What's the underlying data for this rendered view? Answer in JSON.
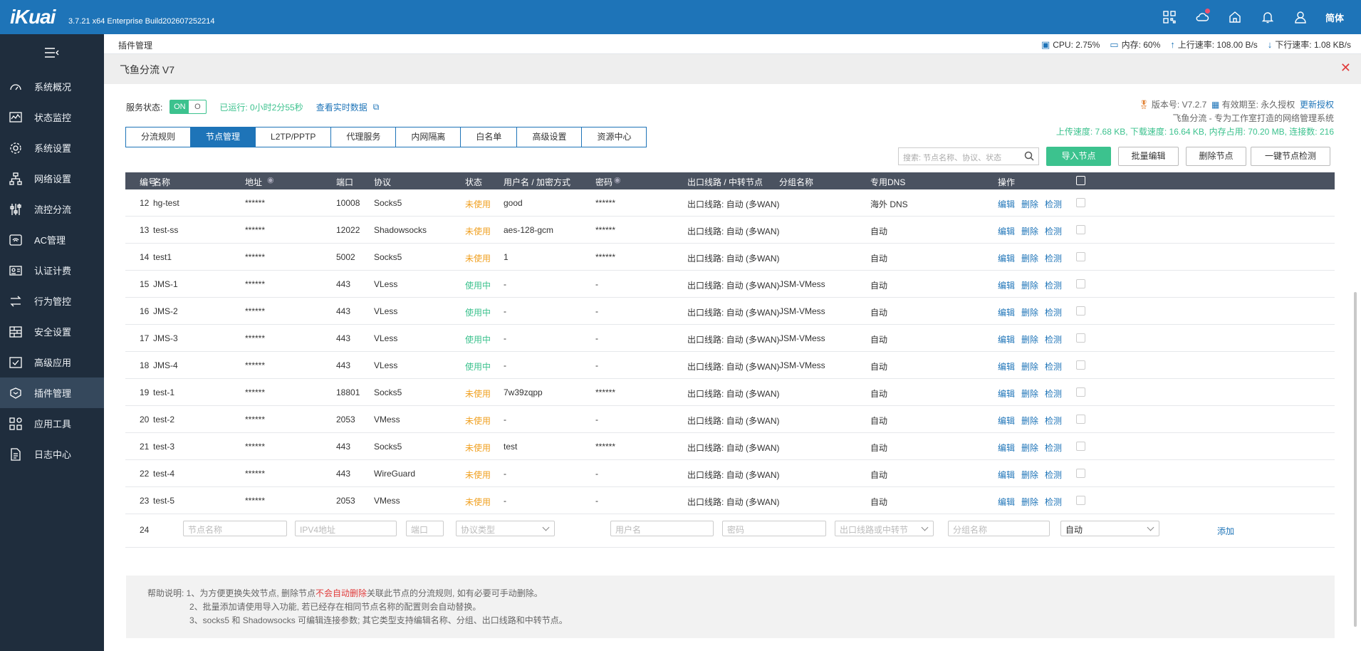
{
  "topbar": {
    "logo": "iKuai",
    "version": "3.7.21 x64 Enterprise Build202607252214",
    "lang": "简体"
  },
  "sidebar": {
    "items": [
      {
        "label": "系统概况",
        "icon": "dashboard-icon"
      },
      {
        "label": "状态监控",
        "icon": "monitor-icon"
      },
      {
        "label": "系统设置",
        "icon": "gear-icon"
      },
      {
        "label": "网络设置",
        "icon": "network-icon"
      },
      {
        "label": "流控分流",
        "icon": "sliders-icon"
      },
      {
        "label": "AC管理",
        "icon": "wifi-icon"
      },
      {
        "label": "认证计费",
        "icon": "id-card-icon"
      },
      {
        "label": "行为管控",
        "icon": "arrows-icon"
      },
      {
        "label": "安全设置",
        "icon": "firewall-icon"
      },
      {
        "label": "高级应用",
        "icon": "check-square-icon"
      },
      {
        "label": "插件管理",
        "icon": "plugin-icon"
      },
      {
        "label": "应用工具",
        "icon": "apps-icon"
      },
      {
        "label": "日志中心",
        "icon": "document-icon"
      }
    ],
    "active_index": 10
  },
  "statusbar": {
    "breadcrumb": "插件管理",
    "cpu": "CPU: 2.75%",
    "memory": "内存: 60%",
    "upload": "上行速率: 108.00 B/s",
    "download": "下行速率: 1.08 KB/s"
  },
  "panel": {
    "title": "飞鱼分流 V7",
    "service_label": "服务状态:",
    "toggle_on": "ON",
    "toggle_off": "O",
    "runtime": "已运行: 0小时2分55秒",
    "realtime_link": "查看实时数据",
    "version_label": "版本号: V7.2.7",
    "validity": "有效期至: 永久授权",
    "update_license": "更新授权",
    "tagline": "飞鱼分流 - 专为工作室打造的网络管理系统",
    "speeds": "上传速度: 7.68 KB, 下载速度: 16.64 KB, 内存占用: 70.20 MB, 连接数: 216"
  },
  "tabs": [
    "分流规则",
    "节点管理",
    "L2TP/PPTP",
    "代理服务",
    "内网隔离",
    "白名单",
    "高级设置",
    "资源中心"
  ],
  "active_tab": 1,
  "toolbar": {
    "search_placeholder": "搜索: 节点名称、协议、状态",
    "import": "导入节点",
    "batch_edit": "批量编辑",
    "delete": "删除节点",
    "check_all": "一键节点检测"
  },
  "table": {
    "headers": [
      "编号",
      "名称",
      "地址",
      "端口",
      "协议",
      "状态",
      "用户名 / 加密方式",
      "密码",
      "出口线路 / 中转节点",
      "分组名称",
      "专用DNS",
      "操作"
    ],
    "actions": [
      "编辑",
      "删除",
      "检测"
    ],
    "rows": [
      {
        "id": "12",
        "name": "hg-test",
        "addr": "******",
        "port": "10008",
        "proto": "Socks5",
        "status": "未使用",
        "used": false,
        "user": "good",
        "pwd": "******",
        "exit": "出口线路: 自动 (多WAN)",
        "group": "",
        "dns": "海外 DNS"
      },
      {
        "id": "13",
        "name": "test-ss",
        "addr": "******",
        "port": "12022",
        "proto": "Shadowsocks",
        "status": "未使用",
        "used": false,
        "user": "aes-128-gcm",
        "pwd": "******",
        "exit": "出口线路: 自动 (多WAN)",
        "group": "",
        "dns": "自动"
      },
      {
        "id": "14",
        "name": "test1",
        "addr": "******",
        "port": "5002",
        "proto": "Socks5",
        "status": "未使用",
        "used": false,
        "user": "1",
        "pwd": "******",
        "exit": "出口线路: 自动 (多WAN)",
        "group": "",
        "dns": "自动"
      },
      {
        "id": "15",
        "name": "JMS-1",
        "addr": "******",
        "port": "443",
        "proto": "VLess",
        "status": "使用中",
        "used": true,
        "user": "-",
        "pwd": "-",
        "exit": "出口线路: 自动 (多WAN)",
        "group": "JSM-VMess",
        "dns": "自动"
      },
      {
        "id": "16",
        "name": "JMS-2",
        "addr": "******",
        "port": "443",
        "proto": "VLess",
        "status": "使用中",
        "used": true,
        "user": "-",
        "pwd": "-",
        "exit": "出口线路: 自动 (多WAN)",
        "group": "JSM-VMess",
        "dns": "自动"
      },
      {
        "id": "17",
        "name": "JMS-3",
        "addr": "******",
        "port": "443",
        "proto": "VLess",
        "status": "使用中",
        "used": true,
        "user": "-",
        "pwd": "-",
        "exit": "出口线路: 自动 (多WAN)",
        "group": "JSM-VMess",
        "dns": "自动"
      },
      {
        "id": "18",
        "name": "JMS-4",
        "addr": "******",
        "port": "443",
        "proto": "VLess",
        "status": "使用中",
        "used": true,
        "user": "-",
        "pwd": "-",
        "exit": "出口线路: 自动 (多WAN)",
        "group": "JSM-VMess",
        "dns": "自动"
      },
      {
        "id": "19",
        "name": "test-1",
        "addr": "******",
        "port": "18801",
        "proto": "Socks5",
        "status": "未使用",
        "used": false,
        "user": "7w39zqpp",
        "pwd": "******",
        "exit": "出口线路: 自动 (多WAN)",
        "group": "",
        "dns": "自动"
      },
      {
        "id": "20",
        "name": "test-2",
        "addr": "******",
        "port": "2053",
        "proto": "VMess",
        "status": "未使用",
        "used": false,
        "user": "-",
        "pwd": "-",
        "exit": "出口线路: 自动 (多WAN)",
        "group": "",
        "dns": "自动"
      },
      {
        "id": "21",
        "name": "test-3",
        "addr": "******",
        "port": "443",
        "proto": "Socks5",
        "status": "未使用",
        "used": false,
        "user": "test",
        "pwd": "******",
        "exit": "出口线路: 自动 (多WAN)",
        "group": "",
        "dns": "自动"
      },
      {
        "id": "22",
        "name": "test-4",
        "addr": "******",
        "port": "443",
        "proto": "WireGuard",
        "status": "未使用",
        "used": false,
        "user": "-",
        "pwd": "-",
        "exit": "出口线路: 自动 (多WAN)",
        "group": "",
        "dns": "自动"
      },
      {
        "id": "23",
        "name": "test-5",
        "addr": "******",
        "port": "2053",
        "proto": "VMess",
        "status": "未使用",
        "used": false,
        "user": "-",
        "pwd": "-",
        "exit": "出口线路: 自动 (多WAN)",
        "group": "",
        "dns": "自动"
      }
    ]
  },
  "add_row": {
    "id": "24",
    "name_ph": "节点名称",
    "addr_ph": "IPV4地址",
    "port_ph": "端口",
    "proto_ph": "协议类型",
    "user_ph": "用户名",
    "pwd_ph": "密码",
    "exit_ph": "出口线路或中转节",
    "group_ph": "分组名称",
    "dns_value": "自动",
    "add_label": "添加"
  },
  "help": {
    "prefix": "帮助说明: 1、为方便更换失效节点, 删除节点",
    "red": "不会自动删除",
    "suffix": "关联此节点的分流规则, 如有必要可手动删除。",
    "line2": "2、批量添加请使用导入功能, 若已经存在相同节点名称的配置则会自动替换。",
    "line3": "3、socks5 和 Shadowsocks 可编辑连接参数; 其它类型支持编辑名称、分组、出口线路和中转节点。"
  }
}
